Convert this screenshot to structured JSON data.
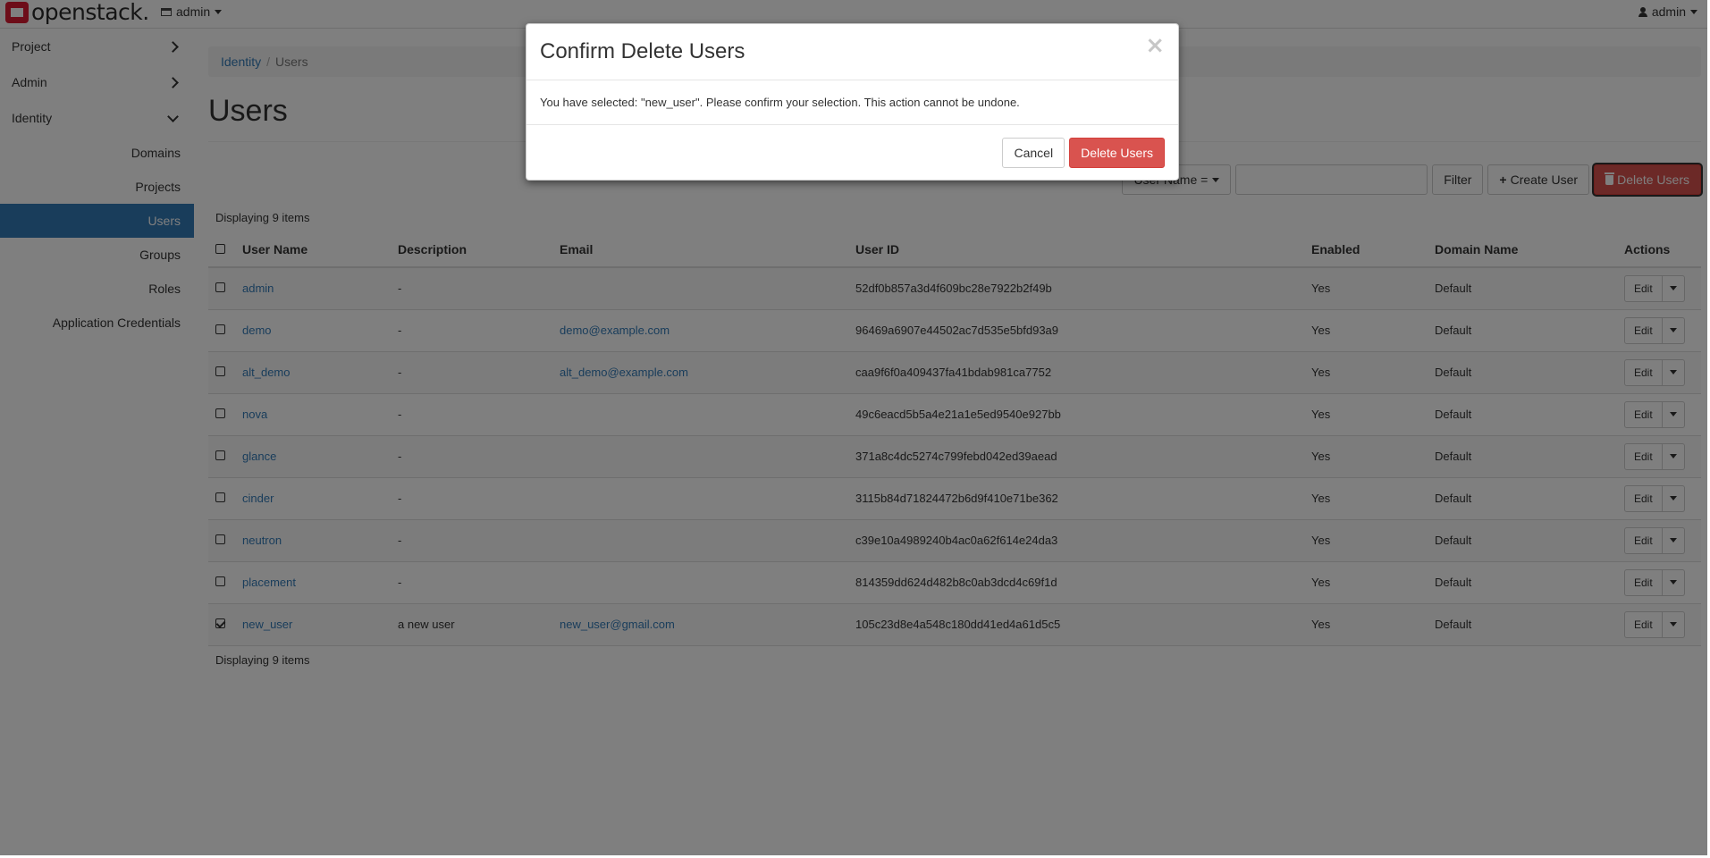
{
  "navbar": {
    "brand": "openstack.",
    "project": "admin",
    "user": "admin"
  },
  "sidebar": {
    "panels": [
      "Project",
      "Admin",
      "Identity"
    ],
    "items": [
      "Domains",
      "Projects",
      "Users",
      "Groups",
      "Roles",
      "Application Credentials"
    ],
    "active": "Users"
  },
  "breadcrumb": {
    "root": "Identity",
    "current": "Users"
  },
  "page": {
    "title": "Users"
  },
  "toolbar": {
    "filter_select": "User Name =",
    "filter_button": "Filter",
    "create_button": "Create User",
    "delete_button": "Delete Users"
  },
  "table": {
    "count_top": "Displaying 9 items",
    "count_bottom": "Displaying 9 items",
    "columns": [
      "User Name",
      "Description",
      "Email",
      "User ID",
      "Enabled",
      "Domain Name",
      "Actions"
    ],
    "rows": [
      {
        "name": "admin",
        "desc": "-",
        "email": "",
        "id": "52df0b857a3d4f609bc28e7922b2f49b",
        "enabled": "Yes",
        "domain": "Default",
        "action": "Edit",
        "checked": false
      },
      {
        "name": "demo",
        "desc": "-",
        "email": "demo@example.com",
        "id": "96469a6907e44502ac7d535e5bfd93a9",
        "enabled": "Yes",
        "domain": "Default",
        "action": "Edit",
        "checked": false
      },
      {
        "name": "alt_demo",
        "desc": "-",
        "email": "alt_demo@example.com",
        "id": "caa9f6f0a409437fa41bdab981ca7752",
        "enabled": "Yes",
        "domain": "Default",
        "action": "Edit",
        "checked": false
      },
      {
        "name": "nova",
        "desc": "-",
        "email": "",
        "id": "49c6eacd5b5a4e21a1e5ed9540e927bb",
        "enabled": "Yes",
        "domain": "Default",
        "action": "Edit",
        "checked": false
      },
      {
        "name": "glance",
        "desc": "-",
        "email": "",
        "id": "371a8c4dc5274c799febd042ed39aead",
        "enabled": "Yes",
        "domain": "Default",
        "action": "Edit",
        "checked": false
      },
      {
        "name": "cinder",
        "desc": "-",
        "email": "",
        "id": "3115b84d71824472b6d9f410e71be362",
        "enabled": "Yes",
        "domain": "Default",
        "action": "Edit",
        "checked": false
      },
      {
        "name": "neutron",
        "desc": "-",
        "email": "",
        "id": "c39e10a4989240b4ac0a62f614e24da3",
        "enabled": "Yes",
        "domain": "Default",
        "action": "Edit",
        "checked": false
      },
      {
        "name": "placement",
        "desc": "-",
        "email": "",
        "id": "814359dd624d482b8c0ab3dcd4c69f1d",
        "enabled": "Yes",
        "domain": "Default",
        "action": "Edit",
        "checked": false
      },
      {
        "name": "new_user",
        "desc": "a new user",
        "email": "new_user@gmail.com",
        "id": "105c23d8e4a548c180dd41ed4a61d5c5",
        "enabled": "Yes",
        "domain": "Default",
        "action": "Edit",
        "checked": true
      }
    ]
  },
  "modal": {
    "title": "Confirm Delete Users",
    "close": "×",
    "message": "You have selected: \"new_user\". Please confirm your selection. This action cannot be undone.",
    "cancel": "Cancel",
    "confirm": "Delete Users"
  },
  "colors": {
    "primary": "#337ab7",
    "danger": "#d9534f",
    "brand": "#da1a32"
  }
}
